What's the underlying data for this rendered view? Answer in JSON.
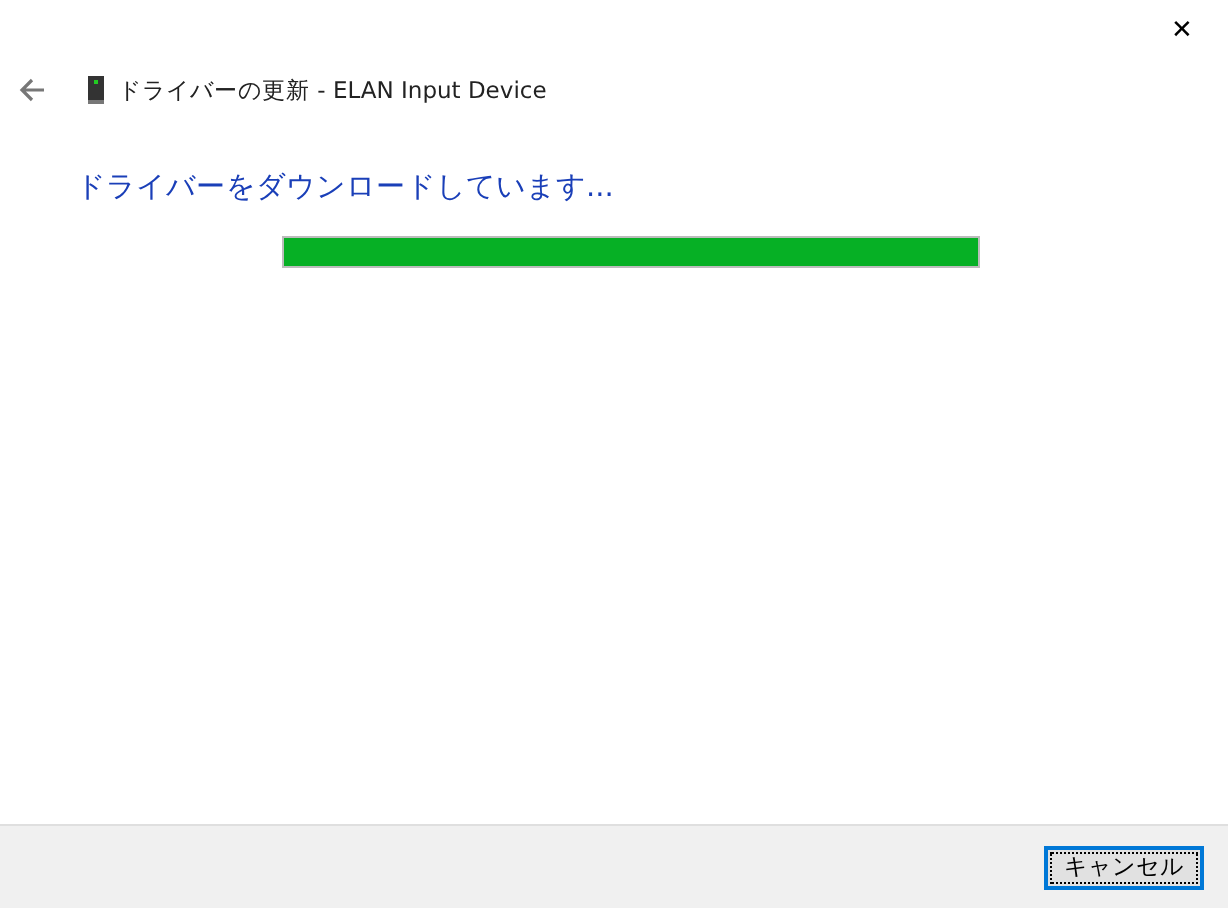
{
  "window": {
    "close": "✕"
  },
  "header": {
    "title": "ドライバーの更新 - ELAN Input Device"
  },
  "heading": "ドライバーをダウンロードしています...",
  "progress": {
    "level": 1
  },
  "buttons": [
    {
      "label": "キャンセル",
      "focused": true
    }
  ]
}
